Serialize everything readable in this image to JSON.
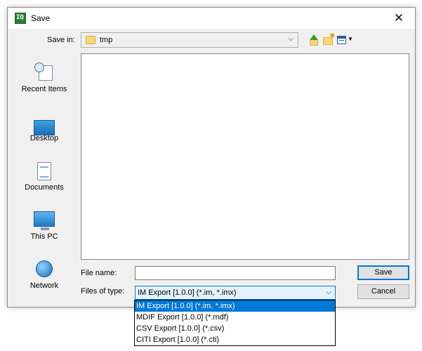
{
  "window": {
    "title": "Save",
    "app_icon_text": "IQ"
  },
  "toolbar": {
    "save_in_label": "Save in:",
    "save_in_value": "tmp"
  },
  "places": [
    {
      "label": "Recent Items",
      "icon": "recent-items-icon"
    },
    {
      "label": "Desktop",
      "icon": "desktop-icon"
    },
    {
      "label": "Documents",
      "icon": "documents-icon"
    },
    {
      "label": "This PC",
      "icon": "computer-icon"
    },
    {
      "label": "Network",
      "icon": "network-icon"
    }
  ],
  "form": {
    "file_name_label": "File name:",
    "file_name_value": "",
    "files_of_type_label": "Files of type:",
    "files_of_type_value": "IM Export [1.0.0] (*.im, *.imx)",
    "save_label": "Save",
    "cancel_label": "Cancel"
  },
  "type_options": [
    "IM Export [1.0.0] (*.im, *.imx)",
    "MDIF Export [1.0.0] (*.mdf)",
    "CSV Export [1.0.0] (*.csv)",
    "CITI Export [1.0.0] (*.cti)"
  ],
  "colors": {
    "accent": "#0078d7",
    "folder": "#f8d775"
  }
}
